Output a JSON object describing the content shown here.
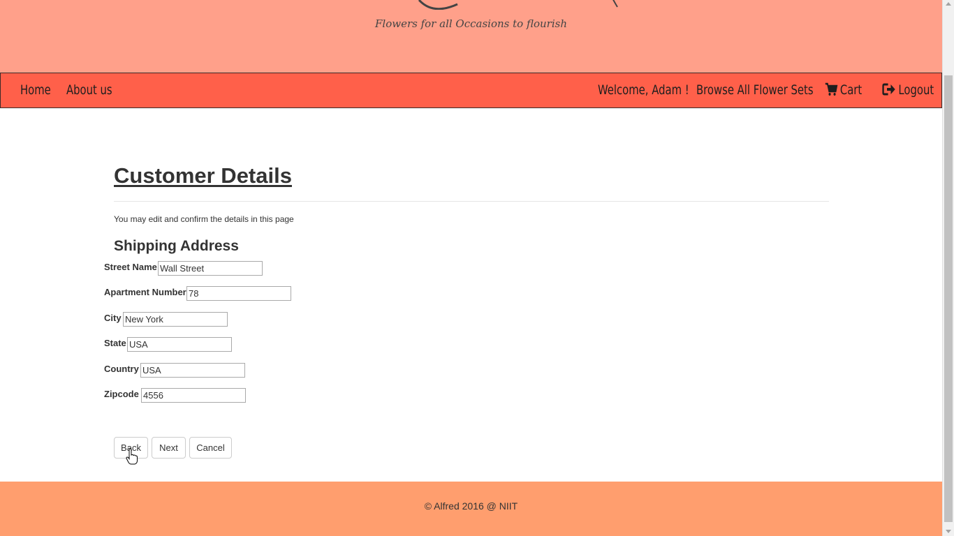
{
  "header": {
    "tagline": "Flowers for all Occasions to flourish"
  },
  "nav": {
    "home": "Home",
    "about": "About us",
    "welcome": "Welcome, Adam !",
    "browse": "Browse All Flower Sets",
    "cart": "Cart",
    "logout": "Logout",
    "cart_icon": "cart-icon",
    "logout_icon": "logout-icon"
  },
  "main": {
    "title": "Customer Details",
    "subtitle": "You may edit and confirm the details in this page",
    "section_title": "Shipping Address",
    "fields": {
      "street": {
        "label": "Street Name",
        "value": "Wall Street"
      },
      "apartment": {
        "label": "Apartment Number",
        "value": "78"
      },
      "city": {
        "label": "City",
        "value": "New York"
      },
      "state": {
        "label": "State",
        "value": "USA"
      },
      "country": {
        "label": "Country",
        "value": "USA"
      },
      "zipcode": {
        "label": "Zipcode",
        "value": "4556"
      }
    },
    "buttons": {
      "back": "Back",
      "next": "Next",
      "cancel": "Cancel"
    }
  },
  "footer": {
    "text": "© Alfred 2016 @ NIIT"
  },
  "colors": {
    "banner": "#ffa08a",
    "navbar": "#ff604a",
    "footer": "#ff9e6e"
  }
}
